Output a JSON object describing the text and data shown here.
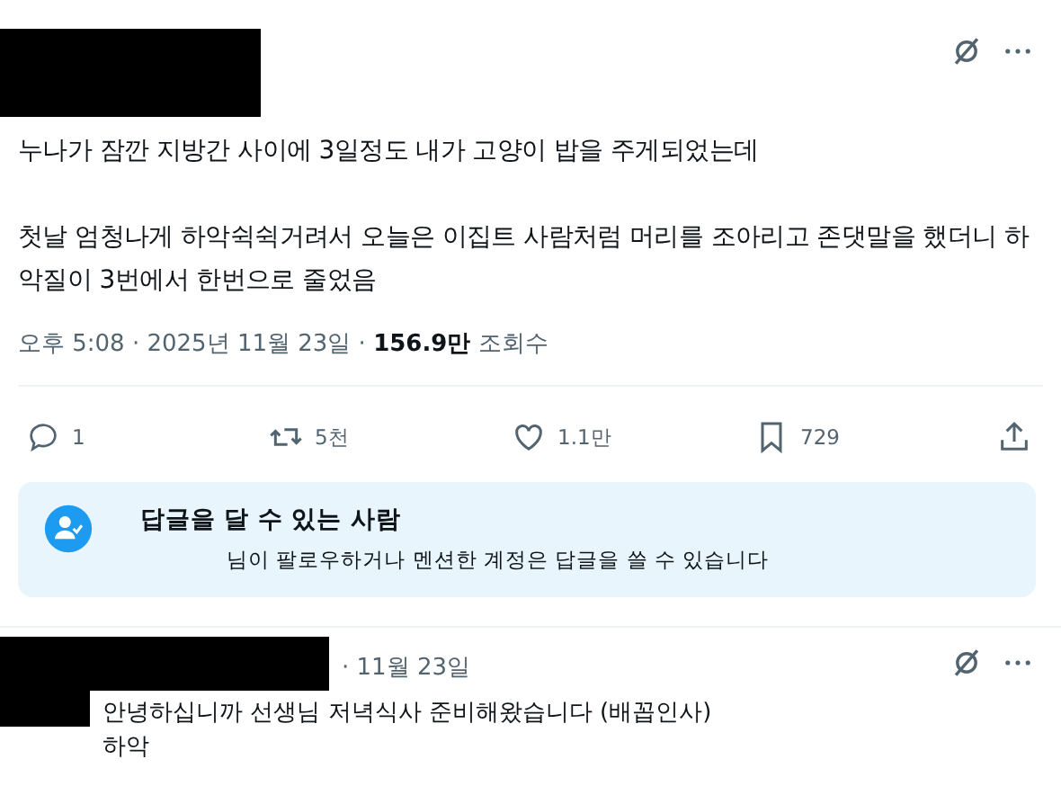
{
  "post": {
    "paragraphs": [
      "누나가 잠깐 지방간 사이에 3일정도 내가 고양이 밥을 주게되었는데",
      "첫날 엄청나게 하악쉭쉭거려서 오늘은 이집트 사람처럼 머리를 조아리고 존댓말을 했더니 하악질이 3번에서 한번으로 줄었음"
    ],
    "time": "오후 5:08 · 2025년 11월 23일 · ",
    "views": "156.9만",
    "views_label": " 조회수"
  },
  "actions": [
    {
      "kind": "reply",
      "count": "1"
    },
    {
      "kind": "repost",
      "count": "5천"
    },
    {
      "kind": "like",
      "count": "1.1만"
    },
    {
      "kind": "bookmark",
      "count": "729"
    },
    {
      "kind": "share"
    }
  ],
  "reply_notice": {
    "title": "답글을 달 수 있는 사람",
    "text": "님이 팔로우하거나 멘션한 계정은 답글을 쓸 수 있습니다"
  },
  "reply": {
    "date": "· 11월 23일",
    "lines": [
      "안녕하십니까 선생님 저녁식사 준비해왔습니다 (배꼽인사)",
      "하악"
    ]
  }
}
